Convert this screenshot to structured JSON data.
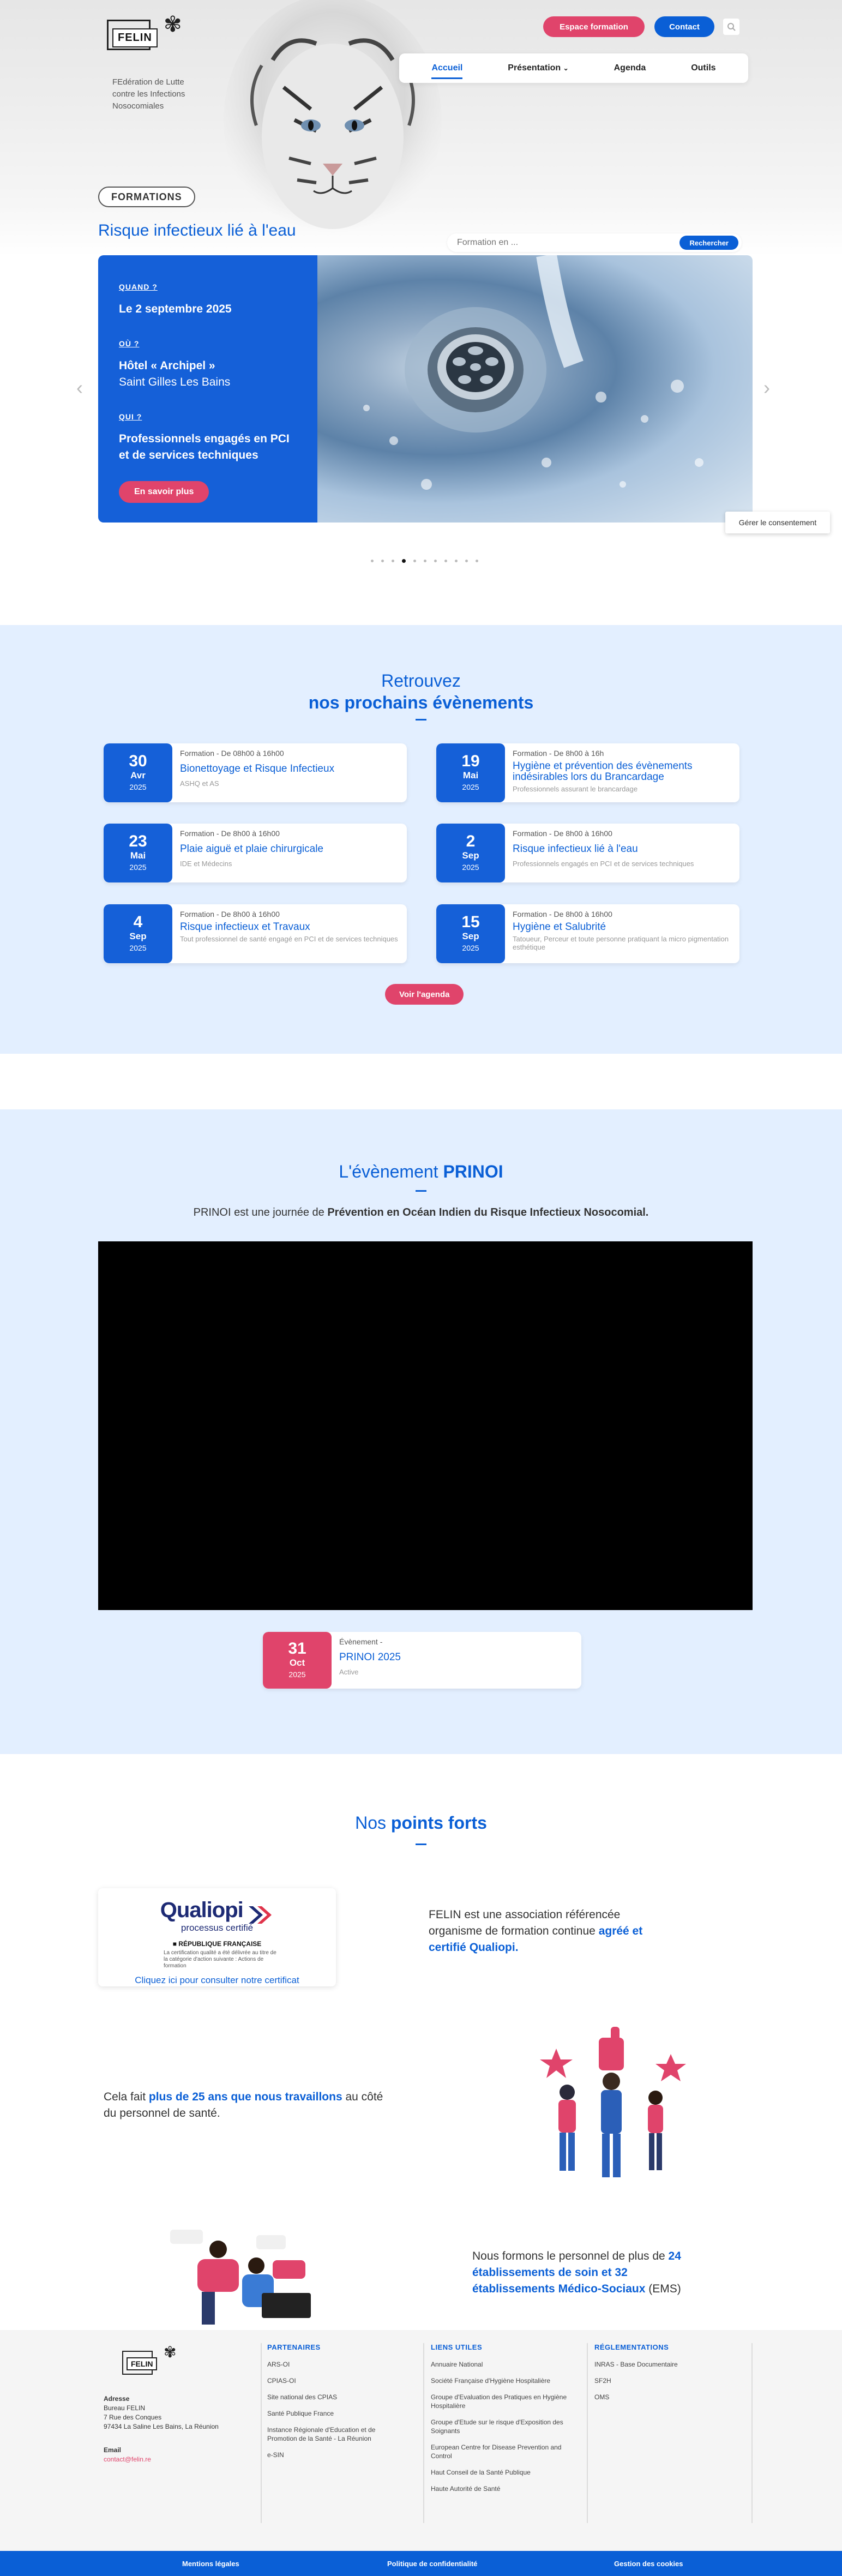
{
  "header": {
    "logo_text": "FELIN",
    "logo_lines": [
      "FEdération de Lutte",
      "contre les Infections",
      "Nosocomiales"
    ],
    "btn_formation": "Espace formation",
    "btn_contact": "Contact",
    "nav": [
      "Accueil",
      "Présentation",
      "Agenda",
      "Outils"
    ]
  },
  "hero": {
    "tag": "FORMATIONS",
    "title": "Risque infectieux lié à l'eau",
    "search_placeholder": "Formation en ...",
    "search_button": "Rechercher"
  },
  "slide": {
    "q1": "QUAND ?",
    "a1": "Le 2 septembre 2025",
    "q2": "OÙ ?",
    "a2_line1": "Hôtel « Archipel »",
    "a2_line2": "Saint Gilles Les Bains",
    "q3": "QUI ?",
    "a3_line1": "Professionnels engagés en PCI",
    "a3_line2": "et de services techniques",
    "button": "En savoir plus",
    "arrow_left": "‹",
    "arrow_right": "›"
  },
  "consent": "Gérer le consentement",
  "events_section": {
    "title_line1": "Retrouvez",
    "title_line2": "nos prochains évènements",
    "agenda_button": "Voir l'agenda",
    "events": [
      {
        "day": "30",
        "month": "Avr",
        "year": "2025",
        "type": "Formation - De 08h00 à 16h00",
        "title": "Bionettoyage et Risque Infectieux",
        "audience": "ASHQ et AS"
      },
      {
        "day": "19",
        "month": "Mai",
        "year": "2025",
        "type": "Formation - De 8h00 à 16h",
        "title": "Hygiène et prévention des évènements indésirables lors du Brancardage",
        "audience": "Professionnels assurant le brancardage"
      },
      {
        "day": "23",
        "month": "Mai",
        "year": "2025",
        "type": "Formation - De 8h00 à 16h00",
        "title": "Plaie aiguë et plaie chirurgicale",
        "audience": "IDE et Médecins"
      },
      {
        "day": "2",
        "month": "Sep",
        "year": "2025",
        "type": "Formation - De 8h00 à 16h00",
        "title": "Risque infectieux lié à l'eau",
        "audience": "Professionnels engagés en PCI et de services techniques"
      },
      {
        "day": "4",
        "month": "Sep",
        "year": "2025",
        "type": "Formation - De 8h00 à 16h00",
        "title": "Risque infectieux et Travaux",
        "audience": "Tout professionnel de santé engagé en PCI et de services techniques"
      },
      {
        "day": "15",
        "month": "Sep",
        "year": "2025",
        "type": "Formation - De 8h00 à 16h00",
        "title": "Hygiène et Salubrité",
        "audience": "Tatoueur, Perceur et toute personne pratiquant la micro pigmentation esthétique"
      }
    ]
  },
  "prinoi_section": {
    "title_plain": "L'évènement ",
    "title_bold": "PRINOI",
    "intro_plain": "PRINOI est une journée de ",
    "intro_bold": "Prévention en Océan Indien du Risque Infectieux Nosocomial.",
    "card": {
      "day": "31",
      "month": "Oct",
      "year": "2025",
      "type": "Évènement -",
      "title": "PRINOI 2025",
      "audience": "Active"
    }
  },
  "points_forts": {
    "title_plain": "Nos ",
    "title_bold": "points forts",
    "qualiopi_logo": "Qualiopi",
    "qualiopi_sub": "processus certifié",
    "qualiopi_rep": "■ RÉPUBLIQUE FRANÇAISE",
    "qualiopi_fine": "La certification qualité a été délivrée au titre de la catégorie d'action suivante : Actions de formation",
    "qualiopi_link": "Cliquez ici pour consulter notre certificat",
    "p1_plain": "FELIN est une association référencée organisme de formation continue ",
    "p1_bold": "agréé et certifié Qualiopi.",
    "p2_plain1": "Cela fait ",
    "p2_bold": "plus de 25 ans que nous travaillons",
    "p2_plain2": " au côté du personnel de santé.",
    "p3_plain1": "Nous formons le personnel de plus de ",
    "p3_bold": "24 établissements de soin et 32 établissements Médico-Sociaux",
    "p3_plain2": " (EMS)"
  },
  "footer": {
    "address_label": "Adresse",
    "address_lines": [
      "Bureau FELIN",
      "7 Rue des Conques",
      "97434 La Saline Les Bains, La Réunion"
    ],
    "email_label": "Email",
    "email": "contact@felin.re",
    "partenaires_title": "PARTENAIRES",
    "partenaires": [
      "ARS-OI",
      "CPIAS-OI",
      "Site national des CPIAS",
      "Santé Publique France",
      "Instance Régionale d'Education et de Promotion de la Santé - La Réunion",
      "e-SIN"
    ],
    "liens_title": "LIENS UTILES",
    "liens": [
      "Annuaire National",
      "Société Française d'Hygiène Hospitalière",
      "Groupe d'Evaluation des Pratiques en Hygiène Hospitalière",
      "Groupe d'Etude sur le risque d'Exposition des Soignants",
      "European Centre for Disease Prevention and Control",
      "Haut Conseil de la Santé Publique",
      "Haute Autorité de Santé"
    ],
    "reglementations_title": "RÉGLEMENTATIONS",
    "reglementations": [
      "INRAS - Base Documentaire",
      "SF2H",
      "OMS"
    ],
    "bottom": [
      "Mentions légales",
      "Politique de confidentialité",
      "Gestion des cookies"
    ]
  },
  "colors": {
    "primary": "#0a5fd6",
    "accent": "#e0446b",
    "section_bg": "#e3efff"
  }
}
